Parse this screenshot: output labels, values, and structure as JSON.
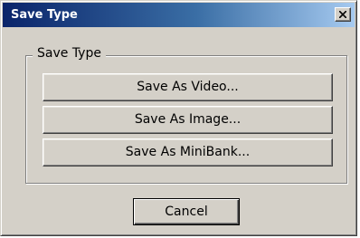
{
  "window": {
    "title": "Save Type",
    "close_icon": "close-icon"
  },
  "group": {
    "label": "Save Type",
    "buttons": [
      {
        "label": "Save As Video..."
      },
      {
        "label": "Save As Image..."
      },
      {
        "label": "Save As MiniBank..."
      }
    ]
  },
  "cancel": {
    "label": "Cancel"
  },
  "colors": {
    "title_bar_start": "#0a246a",
    "title_bar_end": "#a6caf0",
    "face": "#d4d0c8"
  }
}
